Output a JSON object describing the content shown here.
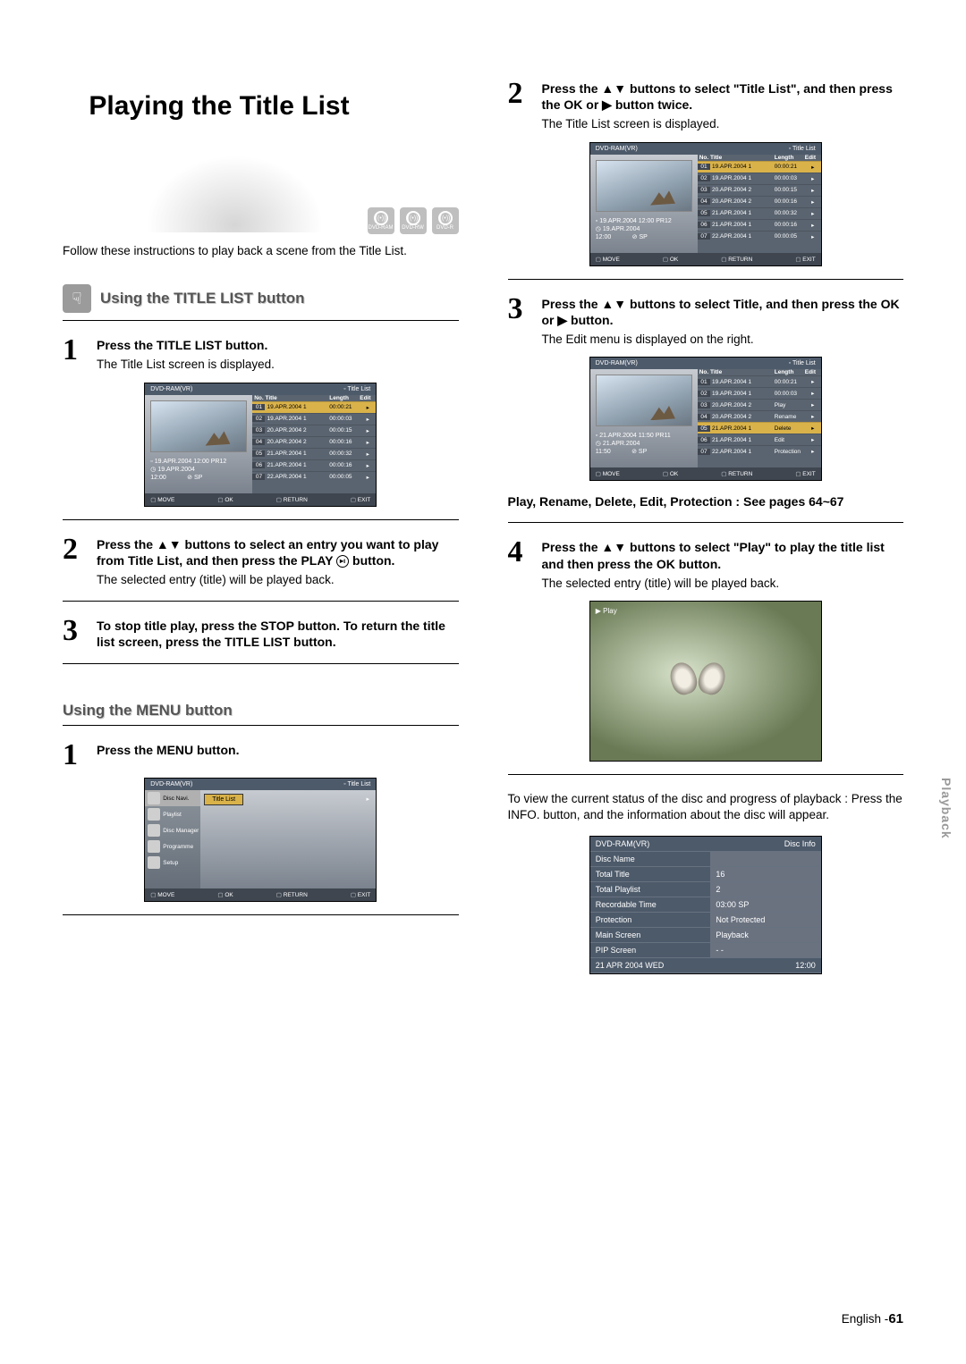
{
  "page_title": "Playing the Title List",
  "disc_types": [
    "DVD-RAM",
    "DVD-RW",
    "DVD-R"
  ],
  "intro": "Follow these instructions to play back a scene from the Title List.",
  "section1_title": "Using the TITLE LIST button",
  "section2_title": "Using the MENU button",
  "left_steps": {
    "s1_bold": "Press the TITLE LIST button.",
    "s1_reg": "The Title List screen is displayed.",
    "s2_bold": "Press the ▲▼ buttons to select an entry you want to play from Title List, and then press the PLAY ",
    "s2_bold_tail": " button.",
    "s2_reg": "The selected entry (title) will be played back.",
    "s3_bold": "To stop title play, press the STOP button. To return the title list screen, press the TITLE LIST button."
  },
  "menu_step1_bold": "Press the MENU button.",
  "right_steps": {
    "s2_bold": "Press the ▲▼ buttons to select \"Title List\", and then press the OK or ▶ button twice.",
    "s2_reg": "The Title List screen is displayed.",
    "s3_bold": "Press the ▲▼ buttons to select Title, and then press the OK or ▶ button.",
    "s3_reg": "The Edit menu is displayed on the right.",
    "cross_ref": "Play, Rename, Delete, Edit, Protection : See pages 64~67",
    "s4_bold": "Press the ▲▼ buttons to select \"Play\" to play the title list and then press the OK button.",
    "s4_reg": "The selected entry (title) will be played back.",
    "final": "To view the current status of the disc and progress of playback : Press the INFO. button, and the information about the disc will appear."
  },
  "osd_hdr_left": "DVD-RAM(VR)",
  "osd_hdr_right": "Title List",
  "osd_cols": {
    "no": "No.",
    "title": "Title",
    "length": "Length",
    "edit": "Edit"
  },
  "osd1_meta": {
    "line1": "19.APR.2004 12:00 PR12",
    "line2": "19.APR.2004",
    "line3a": "12:00",
    "line3b": "SP"
  },
  "osd1_rows": [
    {
      "n": "01",
      "t": "19.APR.2004 1",
      "l": "00:00:21",
      "sel": true
    },
    {
      "n": "02",
      "t": "19.APR.2004 1",
      "l": "00:00:03"
    },
    {
      "n": "03",
      "t": "20.APR.2004 2",
      "l": "00:00:15"
    },
    {
      "n": "04",
      "t": "20.APR.2004 2",
      "l": "00:00:16"
    },
    {
      "n": "05",
      "t": "21.APR.2004 1",
      "l": "00:00:32"
    },
    {
      "n": "06",
      "t": "21.APR.2004 1",
      "l": "00:00:16"
    },
    {
      "n": "07",
      "t": "22.APR.2004 1",
      "l": "00:00:05"
    }
  ],
  "osd_ftr": {
    "move": "MOVE",
    "ok": "OK",
    "ret": "RETURN",
    "exit": "EXIT"
  },
  "menu_items": [
    "Disc Navi.",
    "Playlist",
    "Disc Manager",
    "Programme",
    "Setup"
  ],
  "menu_sub": "Title List",
  "osd3_meta": {
    "line1": "21.APR.2004 11:50 PR11",
    "line2": "21.APR.2004",
    "line3a": "11:50",
    "line3b": "SP"
  },
  "osd3_rows": [
    {
      "n": "01",
      "t": "19.APR.2004 1",
      "l": "00:00:21"
    },
    {
      "n": "02",
      "t": "19.APR.2004 1",
      "l": "00:00:03"
    },
    {
      "n": "03",
      "t": "20.APR.2004 2",
      "l": "Play"
    },
    {
      "n": "04",
      "t": "20.APR.2004 2",
      "l": "Rename"
    },
    {
      "n": "05",
      "t": "21.APR.2004 1",
      "l": "Delete",
      "sel": true
    },
    {
      "n": "06",
      "t": "21.APR.2004 1",
      "l": "Edit"
    },
    {
      "n": "07",
      "t": "22.APR.2004 1",
      "l": "Protection"
    }
  ],
  "play_tag": "▶ Play",
  "disc_info": {
    "header_k": "DVD-RAM(VR)",
    "header_v": "Disc Info",
    "rows": [
      {
        "k": "Disc Name",
        "v": ""
      },
      {
        "k": "Total Title",
        "v": "16"
      },
      {
        "k": "Total Playlist",
        "v": "2"
      },
      {
        "k": "Recordable Time",
        "v": "03:00 SP"
      },
      {
        "k": "Protection",
        "v": "Not Protected"
      },
      {
        "k": "Main Screen",
        "v": "Playback"
      },
      {
        "k": "PIP Screen",
        "v": "- -"
      }
    ],
    "footer_k": "21 APR 2004 WED",
    "footer_v": "12:00"
  },
  "side_tab": "Playback",
  "footer_lang": "English -",
  "footer_page": "61"
}
